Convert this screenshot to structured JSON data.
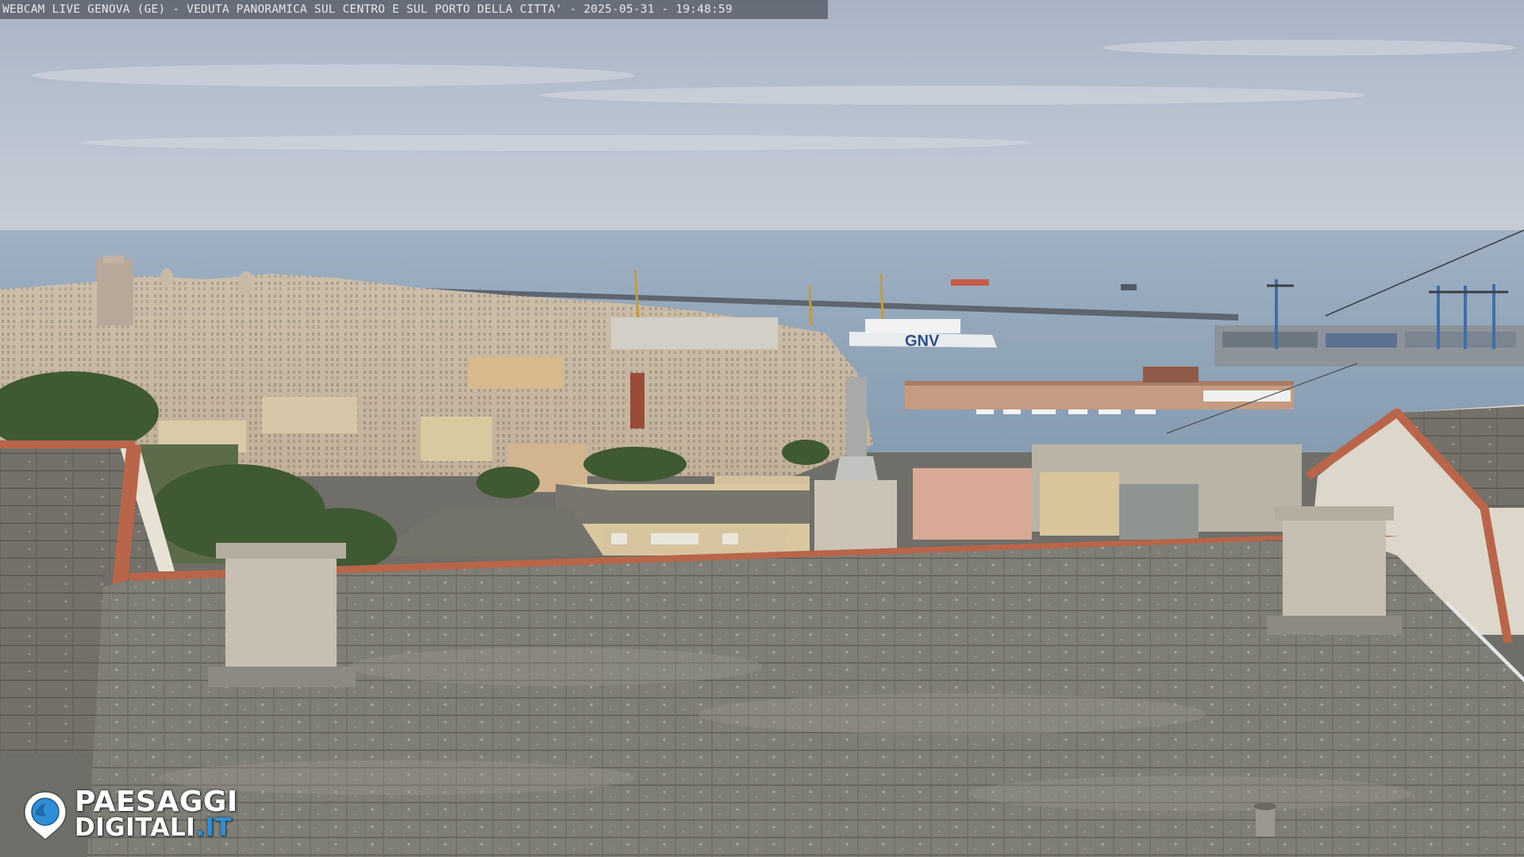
{
  "overlay": {
    "caption": "WEBCAM LIVE GENOVA (GE) - VEDUTA PANORAMICA SUL CENTRO E SUL PORTO DELLA CITTA' - 2025-05-31 - 19:48:59"
  },
  "logo": {
    "line1": "PAESAGGI",
    "line2_main": "DIGITALI",
    "line2_suffix": ".IT"
  },
  "ferry": {
    "hull_text": "GNV"
  },
  "colors": {
    "sky_top": "#b3bccb",
    "sky_horizon": "#c3cbd5",
    "sea": "#8fa4b8",
    "roof_slate": "#77766f",
    "gutter_terracotta": "#b8654a",
    "caption_bar": "#555864",
    "logo_accent": "#2e8fd6"
  }
}
